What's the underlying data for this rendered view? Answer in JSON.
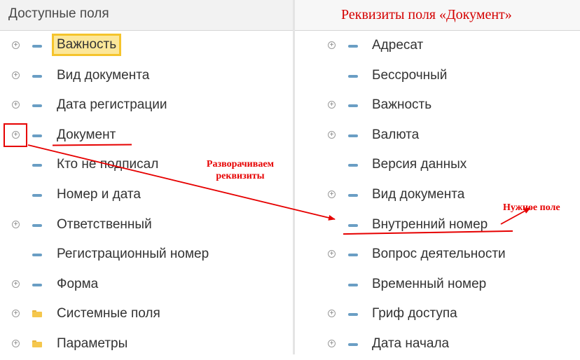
{
  "left_panel": {
    "title": "Доступные поля",
    "items": [
      {
        "label": "Важность",
        "icon": "field-icon",
        "expandable": true,
        "highlighted": true
      },
      {
        "label": "Вид документа",
        "icon": "field-icon",
        "expandable": true
      },
      {
        "label": "Дата регистрации",
        "icon": "field-icon",
        "expandable": true
      },
      {
        "label": "Документ",
        "icon": "field-icon",
        "expandable": true
      },
      {
        "label": "Кто не подписал",
        "icon": "field-icon",
        "expandable": false
      },
      {
        "label": "Номер и дата",
        "icon": "field-icon",
        "expandable": false
      },
      {
        "label": "Ответственный",
        "icon": "field-icon",
        "expandable": true
      },
      {
        "label": "Регистрационный номер",
        "icon": "field-icon",
        "expandable": false
      },
      {
        "label": "Форма",
        "icon": "field-icon",
        "expandable": true
      },
      {
        "label": "Системные поля",
        "icon": "folder-icon",
        "expandable": true
      },
      {
        "label": "Параметры",
        "icon": "folder-icon",
        "expandable": true
      }
    ]
  },
  "right_panel": {
    "title": "Реквизиты поля «Документ»",
    "items": [
      {
        "label": "Адресат",
        "icon": "field-icon",
        "expandable": true
      },
      {
        "label": "Бессрочный",
        "icon": "field-icon",
        "expandable": false
      },
      {
        "label": "Важность",
        "icon": "field-icon",
        "expandable": true
      },
      {
        "label": "Валюта",
        "icon": "field-icon",
        "expandable": true
      },
      {
        "label": "Версия данных",
        "icon": "field-icon",
        "expandable": false
      },
      {
        "label": "Вид документа",
        "icon": "field-icon",
        "expandable": true
      },
      {
        "label": "Внутренний номер",
        "icon": "field-icon",
        "expandable": false
      },
      {
        "label": "Вопрос деятельности",
        "icon": "field-icon",
        "expandable": true
      },
      {
        "label": "Временный номер",
        "icon": "field-icon",
        "expandable": false
      },
      {
        "label": "Гриф доступа",
        "icon": "field-icon",
        "expandable": true
      },
      {
        "label": "Дата начала",
        "icon": "field-icon",
        "expandable": true
      }
    ]
  },
  "annotations": {
    "expand_note_line1": "Разворачиваем",
    "expand_note_line2": "реквизиты",
    "needed_field_note": "Нужное поле"
  },
  "colors": {
    "annotation": "#e60000",
    "highlight_fill": "#fce79a",
    "highlight_border": "#f5c42c",
    "field_icon": "#6a9ec4",
    "folder_icon": "#f5c74d"
  }
}
